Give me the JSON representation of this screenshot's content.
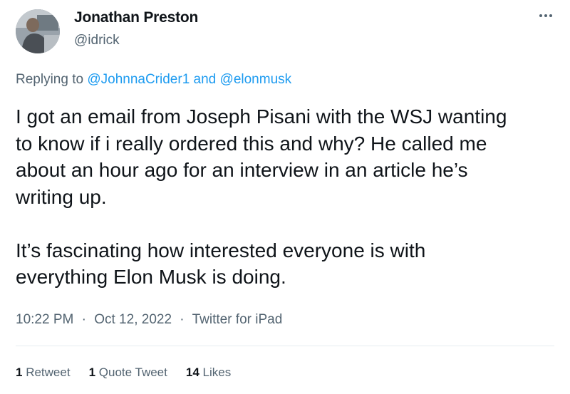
{
  "author": {
    "name": "Jonathan Preston",
    "handle": "@idrick",
    "avatar_icon": "profile-photo"
  },
  "more_icon": "more-options-icon",
  "reply": {
    "prefix": "Replying to",
    "mention1": "@JohnnaCrider1",
    "conjunction": "and",
    "mention2": "@elonmusk"
  },
  "body": {
    "paragraph1": "I got an email from Joseph Pisani with the WSJ wanting\nto know if i really ordered this and why? He called me\nabout an hour ago for an interview in an article he’s\nwriting up.",
    "paragraph2": "It’s fascinating how interested everyone is with\neverything Elon Musk is doing."
  },
  "meta": {
    "time": "10:22 PM",
    "date": "Oct 12, 2022",
    "source": "Twitter for iPad",
    "separator": "·"
  },
  "stats": {
    "retweets_count": "1",
    "retweets_label": "Retweet",
    "quotes_count": "1",
    "quotes_label": "Quote Tweet",
    "likes_count": "14",
    "likes_label": "Likes"
  },
  "colors": {
    "link": "#1d9bf0",
    "secondary_text": "#536471",
    "primary_text": "#0f1419"
  }
}
